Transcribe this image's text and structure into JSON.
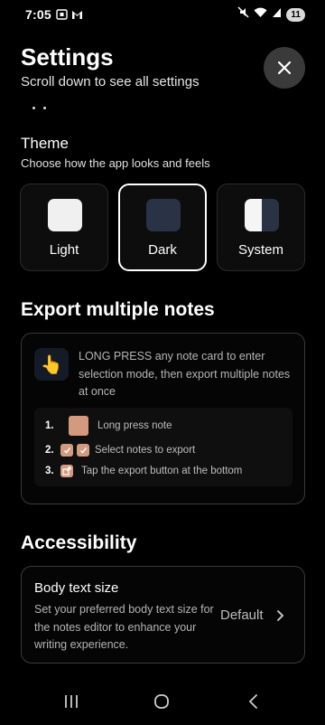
{
  "status_bar": {
    "time": "7:05",
    "battery_level": "11",
    "left_icons": [
      "screenshot-icon",
      "gmail-icon"
    ],
    "right_icons": [
      "mute-icon",
      "wifi-icon",
      "signal-icon"
    ]
  },
  "header": {
    "title": "Settings",
    "subtitle": "Scroll down to see all settings"
  },
  "theme": {
    "title": "Theme",
    "subtitle": "Choose how the app looks and feels",
    "selected": "Dark",
    "options": [
      {
        "label": "Light",
        "color": "#f0f0f0"
      },
      {
        "label": "Dark",
        "color": "#2a3346"
      },
      {
        "label": "System",
        "color": "#ffffff"
      }
    ]
  },
  "export": {
    "title": "Export multiple notes",
    "description": "LONG PRESS any note card to enter selection mode, then export multiple notes at once",
    "steps": [
      {
        "number": "1.",
        "text": "Long press note"
      },
      {
        "number": "2.",
        "text": "Select notes to export"
      },
      {
        "number": "3.",
        "text": "Tap the export button at the bottom"
      }
    ],
    "accent_color": "#d49a80"
  },
  "accessibility": {
    "title": "Accessibility",
    "body_text_size": {
      "title": "Body text size",
      "description": "Set your preferred body text size for the notes editor to enhance your writing experience.",
      "value": "Default"
    }
  },
  "nav_bar": {
    "items": [
      "recents-icon",
      "home-icon",
      "back-icon"
    ]
  }
}
